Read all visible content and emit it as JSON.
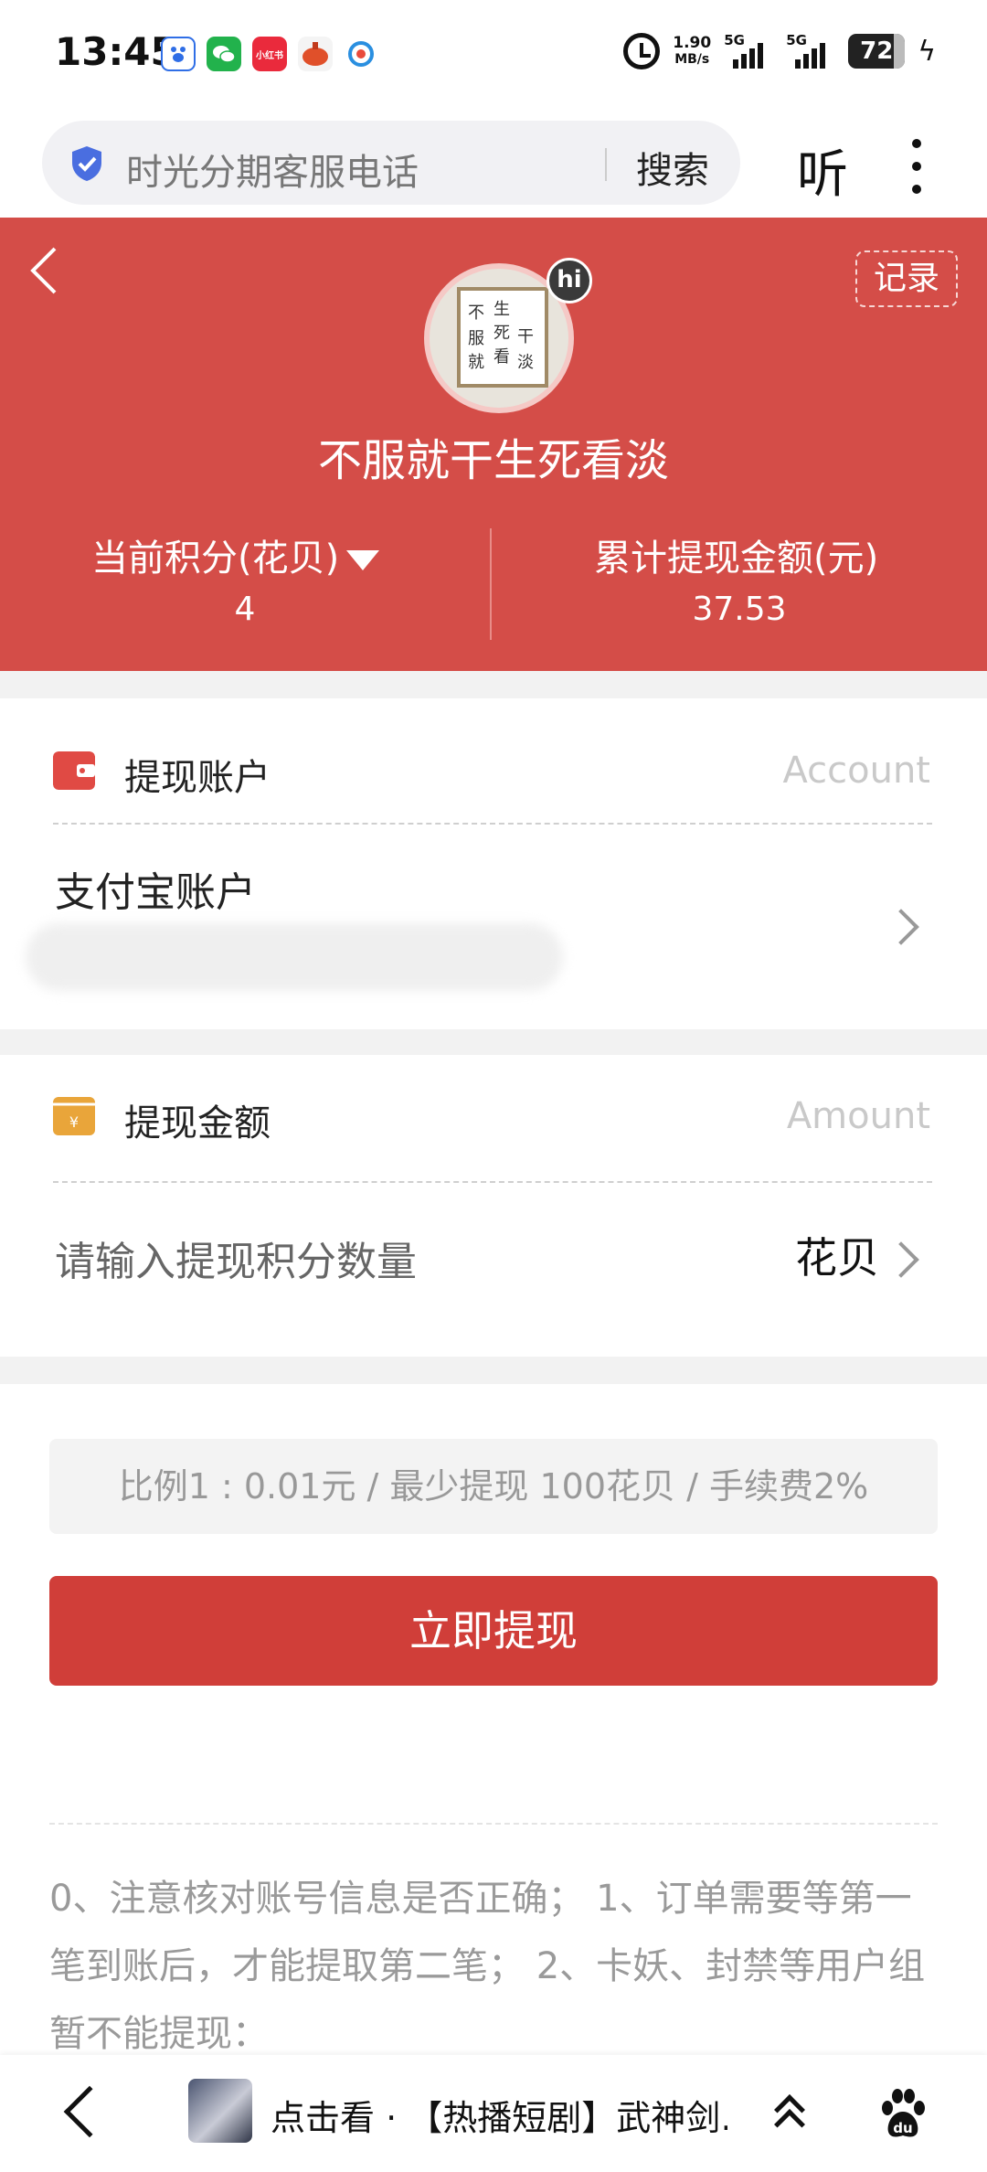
{
  "status_bar": {
    "time": "13:45",
    "net_speed_value": "1.90",
    "net_speed_unit": "MB/s",
    "signal1_label": "5G",
    "signal2_label": "5G",
    "battery": "72",
    "app_icons": [
      "baidu-app-icon",
      "wechat-app-icon",
      "xiaohongshu-app-icon",
      "game-app-icon",
      "browser-app-icon"
    ],
    "xiaohongshu_text": "小红书"
  },
  "search": {
    "query": "时光分期客服电话",
    "button": "搜索",
    "listen": "听"
  },
  "header": {
    "record_button": "记录",
    "avatar_badge": "hi",
    "nickname": "不服就干生死看淡",
    "points_label": "当前积分(花贝)",
    "points_value": "4",
    "total_label": "累计提现金额(元)",
    "total_value": "37.53"
  },
  "account_section": {
    "title": "提现账户",
    "english": "Account",
    "account_type": "支付宝账户"
  },
  "amount_section": {
    "title": "提现金额",
    "english": "Amount",
    "placeholder": "请输入提现积分数量",
    "unit": "花贝"
  },
  "withdraw": {
    "ratio_text": "比例1 : 0.01元 / 最少提现 100花贝 / 手续费2%",
    "button": "立即提现",
    "notes": "0、注意核对账号信息是否正确； 1、订单需要等第一笔到账后，才能提取第二笔； 2、卡妖、封禁等用户组暂不能提现："
  },
  "bottom_bar": {
    "promo_text": "点击看 · 【热播短剧】武神剑…"
  },
  "colors": {
    "header_red": "#d44d48",
    "button_red": "#d03e39",
    "account_icon": "#e04a44",
    "amount_icon": "#e9a53a",
    "shield_blue": "#4a6ee0"
  }
}
